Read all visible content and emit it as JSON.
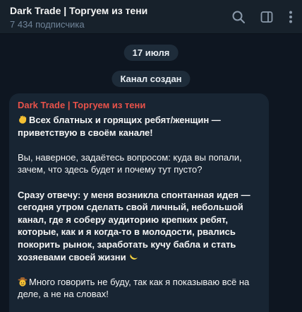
{
  "header": {
    "title": "Dark Trade | Торгуем из тени",
    "subtitle": "7 434 подписчика",
    "icons": [
      "search-icon",
      "sidebar-toggle-icon",
      "more-vertical-icon"
    ]
  },
  "date_label": "17 июля",
  "service_message": "Канал создан",
  "message": {
    "sender": "Dark Trade | Торгуем из тени",
    "p1": "Всех блатных и горящих ребят/женщин — приветствую в своём канале!",
    "p2": "Вы, наверное, задаётесь вопросом: куда вы попали, зачем, что здесь будет и почему тут пусто?",
    "p3": "Сразу отвечу: у меня возникла спонтанная идея — сегодня утром сделать свой личный, небольшой канал, где я соберу аудиторию крепких ребят, которые, как и я когда-то в молодости, рвались покорить рынок, заработать кучу бабла и стать хозяевами своей жизни",
    "p4": "Много говорить не буду, так как я показываю всё на деле, а не на словах!",
    "emojis": [
      "waving-hand-emoji",
      "banana-emoji",
      "cowboy-face-emoji"
    ]
  },
  "colors": {
    "background": "#0e1621",
    "header_bg": "#17212b",
    "bubble_bg": "#182533",
    "sender_name": "#e8524a",
    "subtitle": "#708499"
  }
}
